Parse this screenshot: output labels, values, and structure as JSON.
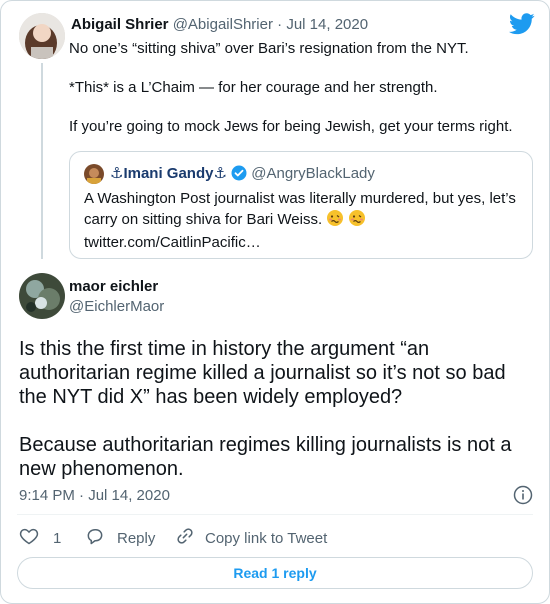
{
  "parent_tweet": {
    "name": "Abigail Shrier",
    "handle": "@AbigailShrier",
    "sep": "·",
    "date": "Jul 14, 2020",
    "line1": "No one’s “sitting shiva” over Bari’s resignation from the NYT.",
    "line2": "*This* is a L’Chaim — for her courage and her strength.",
    "line3": "If you’re going to mock Jews for being Jewish, get your terms right."
  },
  "quoted_tweet": {
    "name": "⚓Imani Gandy⚓",
    "handle": "@AngryBlackLady",
    "text_line1": "A Washington Post journalist was literally murdered, but yes, let’s",
    "text_line2": "carry on sitting shiva for Bari Weiss.",
    "link": "twitter.com/CaitlinPacific…"
  },
  "main_tweet": {
    "name": "maor eichler",
    "handle": "@EichlerMaor",
    "para1_line1": "Is this the first time in history the argument “an",
    "para1_line2": "authoritarian regime killed a journalist so it’s not so bad",
    "para1_line3": "the NYT did X” has been widely employed?",
    "para2_line1": "Because authoritarian regimes killing journalists is not a",
    "para2_line2": "new phenomenon.",
    "timestamp": "9:14 PM · Jul 14, 2020"
  },
  "actions": {
    "like_count": "1",
    "reply_label": "Reply",
    "copy_label": "Copy link to Tweet"
  },
  "read_reply_label": "Read 1 reply",
  "colors": {
    "accent": "#1d9bf0",
    "text": "#0f1419",
    "muted": "#536471",
    "border": "#cfd9de"
  },
  "icons": [
    "twitter-bird-icon",
    "verified-badge-icon",
    "woozy-face-emoji",
    "info-icon",
    "heart-icon",
    "reply-icon",
    "link-icon"
  ]
}
